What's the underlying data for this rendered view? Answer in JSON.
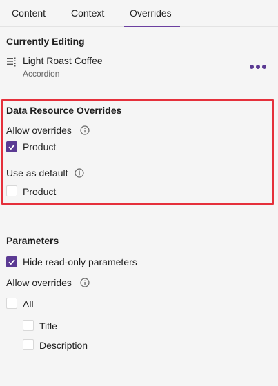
{
  "tabs": [
    {
      "label": "Content"
    },
    {
      "label": "Context"
    },
    {
      "label": "Overrides"
    }
  ],
  "active_tab": "Overrides",
  "currently_editing": {
    "title": "Currently Editing",
    "item_name": "Light Roast Coffee",
    "item_type": "Accordion"
  },
  "data_resource_overrides": {
    "title": "Data Resource Overrides",
    "allow_overrides_label": "Allow overrides",
    "allow_product_label": "Product",
    "allow_product_checked": true,
    "use_as_default_label": "Use as default",
    "default_product_label": "Product",
    "default_product_checked": false
  },
  "parameters": {
    "title": "Parameters",
    "hide_readonly_label": "Hide read-only parameters",
    "hide_readonly_checked": true,
    "allow_overrides_label": "Allow overrides",
    "all_label": "All",
    "all_checked": false,
    "title_label": "Title",
    "title_checked": false,
    "description_label": "Description",
    "description_checked": false
  },
  "colors": {
    "accent": "#5b3a93",
    "highlight_border": "#e5303b",
    "background": "#f5f5f5"
  },
  "icons": [
    "list-icon",
    "more-icon",
    "info-icon",
    "check-icon"
  ]
}
